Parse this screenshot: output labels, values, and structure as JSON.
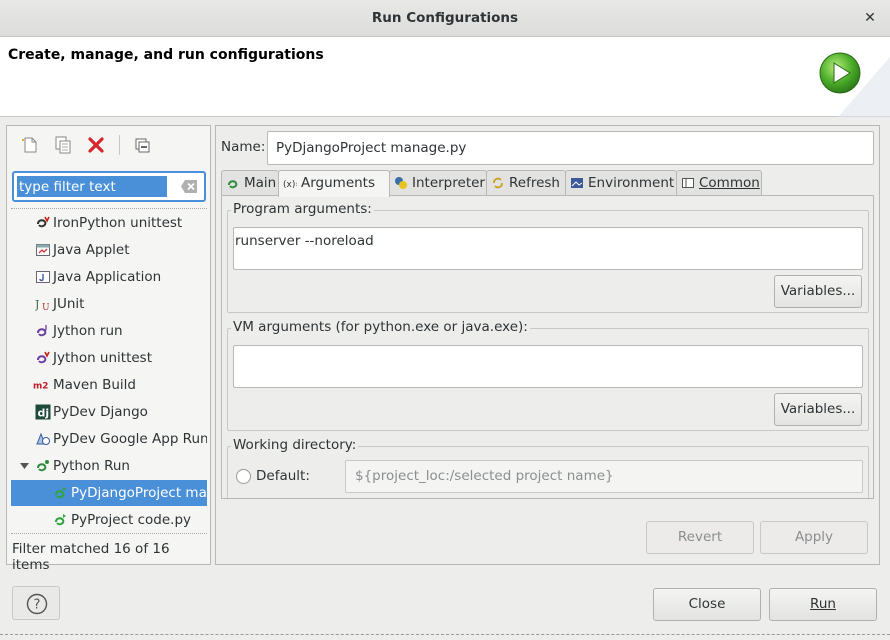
{
  "window": {
    "title": "Run Configurations",
    "close_glyph": "✕"
  },
  "header": {
    "title": "Create, manage, and run configurations",
    "icon": "run-icon"
  },
  "left": {
    "toolbar": [
      "new-config-icon",
      "duplicate-icon",
      "delete-icon",
      "collapse-all-icon"
    ],
    "filter": {
      "placeholder": "type filter text",
      "value": "type filter text"
    },
    "tree": [
      {
        "label": "IronPython unittest",
        "icon": "ironpython-unittest-icon",
        "level": 1
      },
      {
        "label": "Java Applet",
        "icon": "java-applet-icon",
        "level": 1
      },
      {
        "label": "Java Application",
        "icon": "java-application-icon",
        "level": 1
      },
      {
        "label": "JUnit",
        "icon": "junit-icon",
        "level": 1
      },
      {
        "label": "Jython run",
        "icon": "jython-run-icon",
        "level": 1
      },
      {
        "label": "Jython unittest",
        "icon": "jython-unittest-icon",
        "level": 1
      },
      {
        "label": "Maven Build",
        "icon": "maven-icon",
        "level": 1
      },
      {
        "label": "PyDev Django",
        "icon": "django-icon",
        "level": 1
      },
      {
        "label": "PyDev Google App Run",
        "icon": "google-app-icon",
        "level": 1
      },
      {
        "label": "Python Run",
        "icon": "python-run-icon",
        "level": 1,
        "expanded": true
      },
      {
        "label": "PyDjangoProject manage.py",
        "icon": "python-config-icon",
        "level": 2,
        "selected": true
      },
      {
        "label": "PyProject code.py",
        "icon": "python-config-icon",
        "level": 2
      }
    ],
    "status": "Filter matched 16 of 16 items"
  },
  "right": {
    "name_label": "Name:",
    "name_value": "PyDjangoProject manage.py",
    "tabs": [
      {
        "label": "Main",
        "icon": "main-tab-icon"
      },
      {
        "label": "Arguments",
        "icon": "arguments-tab-icon",
        "active": true
      },
      {
        "label": "Interpreter",
        "icon": "interpreter-tab-icon"
      },
      {
        "label": "Refresh",
        "icon": "refresh-tab-icon"
      },
      {
        "label": "Environment",
        "icon": "environment-tab-icon"
      },
      {
        "label": "Common",
        "icon": "common-tab-icon"
      }
    ],
    "program_args": {
      "title": "Program arguments:",
      "value": "runserver --noreload",
      "variables_label": "Variables..."
    },
    "vm_args": {
      "title": "VM arguments (for python.exe or java.exe):",
      "value": "",
      "variables_label": "Variables..."
    },
    "working_dir": {
      "title": "Working directory:",
      "default_label": "Default:",
      "default_value": "${project_loc:/selected project name}"
    },
    "revert_label": "Revert",
    "apply_label": "Apply"
  },
  "footer": {
    "help_glyph": "?",
    "close_label": "Close",
    "run_label": "Run"
  },
  "colors": {
    "selection": "#4a90d9",
    "background": "#ededec"
  }
}
